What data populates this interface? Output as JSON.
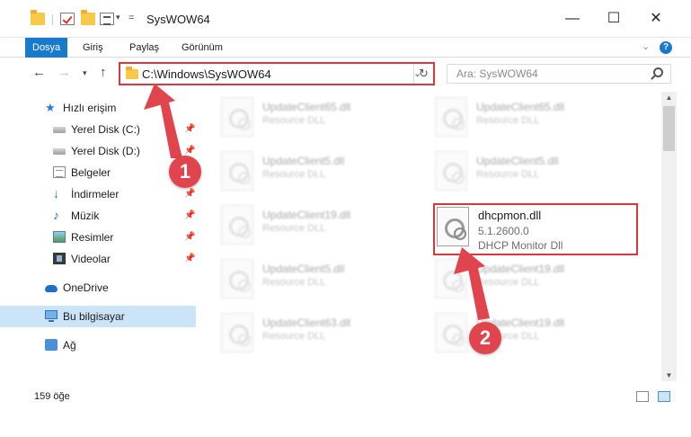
{
  "window": {
    "title": "SysWOW64",
    "minimize": "—",
    "maximize": "☐",
    "close": "✕"
  },
  "ribbon": {
    "tabs": [
      "Dosya",
      "Giriş",
      "Paylaş",
      "Görünüm"
    ],
    "active_tab": "Dosya",
    "expand": "⌄",
    "help": "?"
  },
  "address": {
    "path": "C:\\Windows\\SysWOW64",
    "search_placeholder": "Ara: SysWOW64"
  },
  "nav": {
    "quick_access": "Hızlı erişim",
    "items": [
      {
        "label": "Yerel Disk (C:)",
        "icon": "disk-icon",
        "pinned": true
      },
      {
        "label": "Yerel Disk (D:)",
        "icon": "disk-icon",
        "pinned": true
      },
      {
        "label": "Belgeler",
        "icon": "documents-icon",
        "pinned": true
      },
      {
        "label": "İndirmeler",
        "icon": "downloads-icon",
        "pinned": true
      },
      {
        "label": "Müzik",
        "icon": "music-icon",
        "pinned": true
      },
      {
        "label": "Resimler",
        "icon": "pictures-icon",
        "pinned": true
      },
      {
        "label": "Videolar",
        "icon": "videos-icon",
        "pinned": true
      }
    ],
    "onedrive": "OneDrive",
    "this_pc": "Bu bilgisayar",
    "network": "Ağ"
  },
  "files": {
    "left": [
      {
        "name": "UpdateClient65.dll",
        "desc": "Resource DLL"
      },
      {
        "name": "UpdateClient5.dll",
        "desc": "Resource DLL"
      },
      {
        "name": "UpdateClient19.dll",
        "desc": "Resource DLL"
      },
      {
        "name": "UpdateClient5.dll",
        "desc": "Resource DLL"
      },
      {
        "name": "UpdateClient63.dll",
        "desc": "Resource DLL"
      }
    ],
    "right": [
      {
        "name": "UpdateClient65.dll",
        "desc": "Resource DLL"
      },
      {
        "name": "UpdateClient5.dll",
        "desc": "Resource DLL"
      },
      {
        "name": "UpdateClient19.dll",
        "desc": "Resource DLL"
      },
      {
        "name": "UpdateClient19.dll",
        "desc": "Resource DLL"
      }
    ],
    "highlighted": {
      "name": "dhcpmon.dll",
      "version": "5.1.2600.0",
      "desc": "DHCP Monitor Dll"
    }
  },
  "status": {
    "item_count": "159 öğe"
  },
  "annotations": {
    "step1": "1",
    "step2": "2",
    "color": "#e0444c"
  }
}
